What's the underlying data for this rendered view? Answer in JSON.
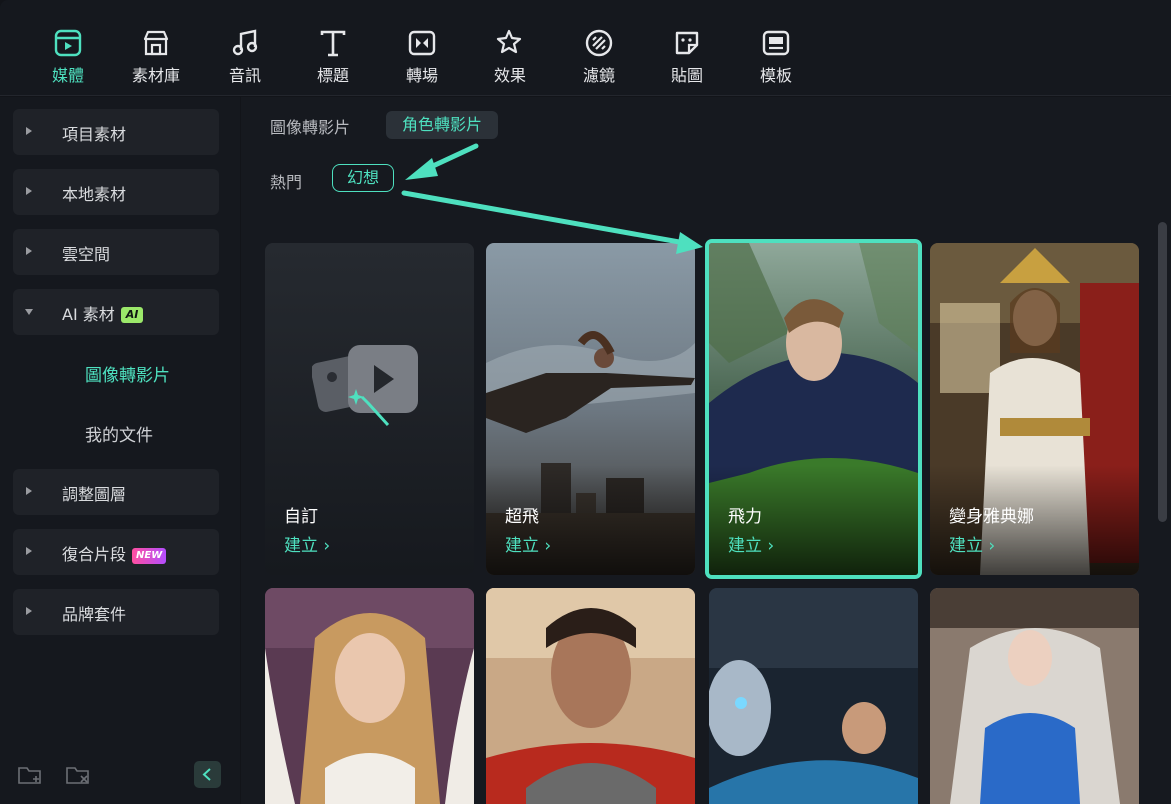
{
  "toolbar": {
    "items": [
      {
        "label": "媒體",
        "icon": "media-icon",
        "active": true
      },
      {
        "label": "素材庫",
        "icon": "store-icon",
        "active": false
      },
      {
        "label": "音訊",
        "icon": "music-note-icon",
        "active": false
      },
      {
        "label": "標題",
        "icon": "text-title-icon",
        "active": false
      },
      {
        "label": "轉場",
        "icon": "transition-icon",
        "active": false
      },
      {
        "label": "效果",
        "icon": "effects-star-icon",
        "active": false
      },
      {
        "label": "濾鏡",
        "icon": "filter-icon",
        "active": false
      },
      {
        "label": "貼圖",
        "icon": "sticker-icon",
        "active": false
      },
      {
        "label": "模板",
        "icon": "template-icon",
        "active": false
      }
    ]
  },
  "sidebar": {
    "items": [
      {
        "label": "項目素材",
        "expanded": false
      },
      {
        "label": "本地素材",
        "expanded": false
      },
      {
        "label": "雲空間",
        "expanded": false
      },
      {
        "label": "AI 素材",
        "badge": "AI",
        "expanded": true
      },
      {
        "label": "調整圖層",
        "expanded": false
      },
      {
        "label": "復合片段",
        "badge": "NEW",
        "expanded": false
      },
      {
        "label": "品牌套件",
        "expanded": false
      }
    ],
    "sub_items": [
      {
        "label": "圖像轉影片",
        "active": true
      },
      {
        "label": "我的文件",
        "active": false
      }
    ]
  },
  "main": {
    "tabs": [
      {
        "label": "圖像轉影片",
        "active": false
      },
      {
        "label": "角色轉影片",
        "active": true
      }
    ],
    "filter": {
      "label": "熱門",
      "selected": "幻想"
    },
    "cards": [
      {
        "title": "自訂",
        "cta": "建立 ›"
      },
      {
        "title": "超飛",
        "cta": "建立 ›"
      },
      {
        "title": "飛力",
        "cta": "建立 ›",
        "highlighted": true
      },
      {
        "title": "變身雅典娜",
        "cta": "建立 ›"
      },
      {
        "title": "",
        "cta": ""
      },
      {
        "title": "",
        "cta": ""
      },
      {
        "title": "",
        "cta": ""
      },
      {
        "title": "",
        "cta": ""
      }
    ]
  },
  "colors": {
    "accent": "#4ee0bf",
    "background": "#121419",
    "panel": "#15181e"
  }
}
